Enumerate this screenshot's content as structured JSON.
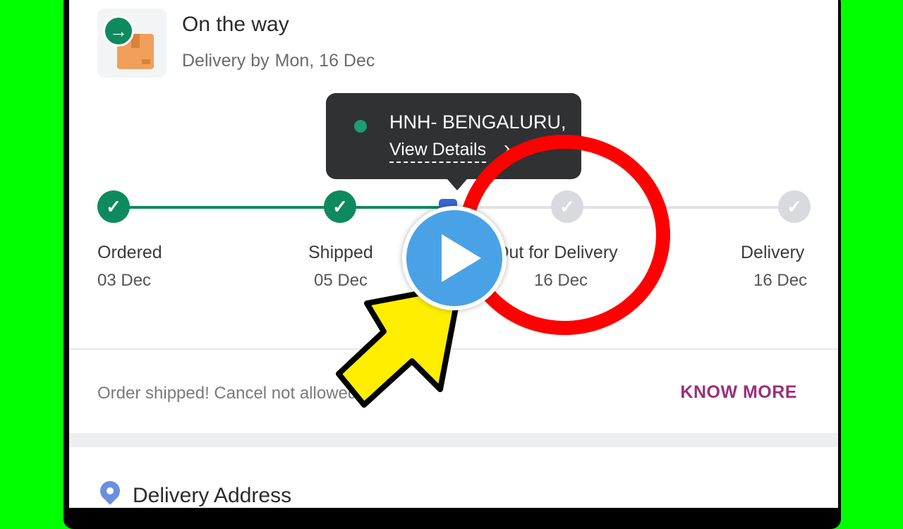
{
  "header": {
    "status": "On the way",
    "delivery_prefix": "Delivery by",
    "delivery_date": "Mon, 16 Dec"
  },
  "tooltip": {
    "location": "HNH- BENGALURU,",
    "link": "View Details",
    "chevron": "›"
  },
  "steps": [
    {
      "label": "Ordered",
      "date": "03 Dec",
      "state": "done"
    },
    {
      "label": "Shipped",
      "date": "05 Dec",
      "state": "done"
    },
    {
      "label": "Out for Delivery",
      "date": "16 Dec",
      "state": "pending"
    },
    {
      "label": "Delivery",
      "date": "16 Dec",
      "state": "pending"
    }
  ],
  "check_glyph": "✓",
  "arrow_glyph": "→",
  "cancel_note": "Order shipped! Cancel not allowed.",
  "know_more": "KNOW MORE",
  "address_title": "Delivery Address",
  "colors": {
    "background": "#00ff00",
    "accent_green": "#0e8a5f",
    "know_more": "#9c2f7a",
    "highlight_circle": "#ff0000",
    "pointer_arrow": "#ffee00",
    "play_button": "#4aa2e6"
  }
}
